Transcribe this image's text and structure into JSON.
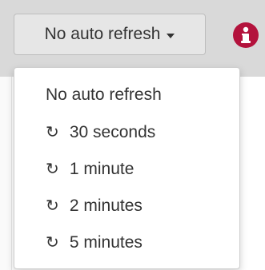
{
  "toolbar": {
    "refresh_button": {
      "label": "No auto refresh"
    },
    "info_icon": "info-icon"
  },
  "dropdown": {
    "items": [
      {
        "label": "No auto refresh",
        "icon": ""
      },
      {
        "label": "30 seconds",
        "icon": "↻"
      },
      {
        "label": "1 minute",
        "icon": "↻"
      },
      {
        "label": "2 minutes",
        "icon": "↻"
      },
      {
        "label": "5 minutes",
        "icon": "↻"
      }
    ]
  },
  "colors": {
    "toolbar_bg": "#d9d9d9",
    "button_bg": "#e6e6e6",
    "info_badge": "#b3123c",
    "text": "#333333"
  }
}
